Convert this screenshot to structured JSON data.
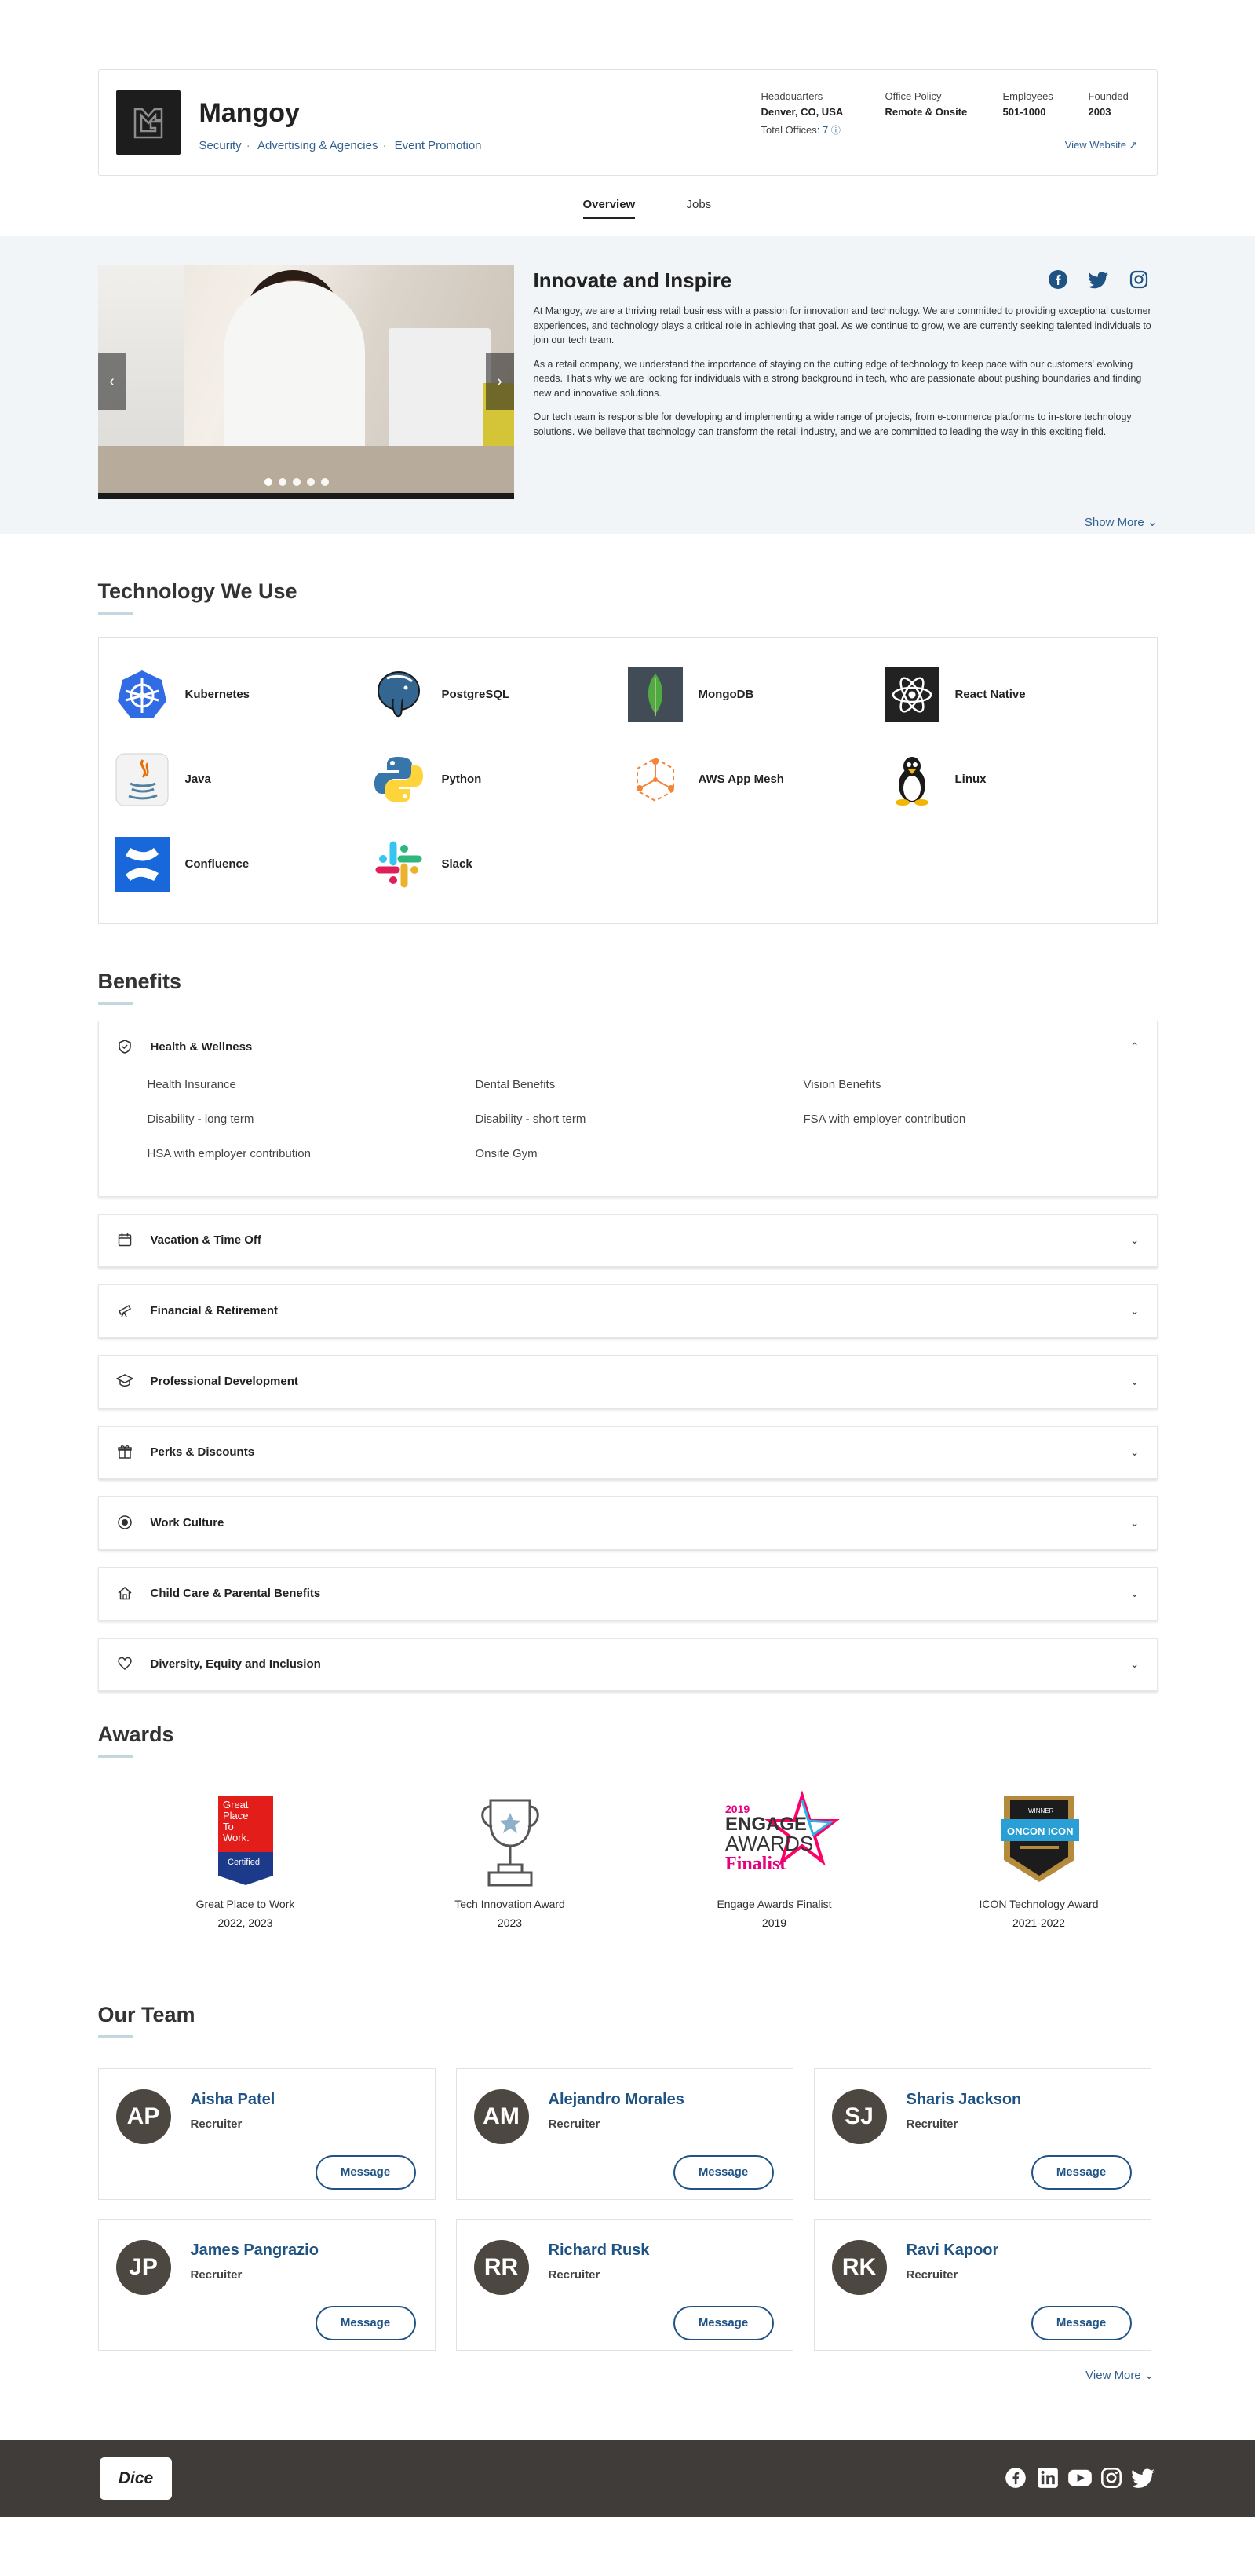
{
  "company": {
    "name": "Mangoy",
    "tags": [
      "Security",
      "Advertising & Agencies",
      "Event Promotion"
    ],
    "facts": [
      {
        "label": "Headquarters",
        "value": "Denver, CO, USA"
      },
      {
        "label": "Office Policy",
        "value": "Remote & Onsite"
      },
      {
        "label": "Employees",
        "value": "501-1000"
      },
      {
        "label": "Founded",
        "value": "2003"
      }
    ],
    "total_offices_label": "Total Offices:",
    "total_offices_value": "7",
    "view_website": "View Website"
  },
  "tabs": [
    "Overview",
    "Jobs"
  ],
  "about": {
    "title": "Innovate and Inspire",
    "paragraphs": [
      "At Mangoy, we are a thriving retail business with a passion for innovation and technology. We are committed to providing exceptional customer experiences, and technology plays a critical role in achieving that goal. As we continue to grow, we are currently seeking talented individuals to join our tech team.",
      "As a retail company, we understand the importance of staying on the cutting edge of technology to keep pace with our customers' evolving needs. That's why we are looking for individuals with a strong background in tech, who are passionate about pushing boundaries and finding new and innovative solutions.",
      "Our tech team is responsible for developing and implementing a wide range of projects, from e-commerce platforms to in-store technology solutions. We believe that technology can transform the retail industry, and we are committed to leading the way in this exciting field."
    ],
    "show_more": "Show More",
    "social_icons": [
      "facebook-icon",
      "twitter-icon",
      "instagram-icon"
    ],
    "carousel_slides": 5,
    "carousel_active": 1
  },
  "tech": {
    "title": "Technology We Use",
    "items": [
      {
        "name": "Kubernetes",
        "icon": "kubernetes-icon"
      },
      {
        "name": "PostgreSQL",
        "icon": "postgresql-icon"
      },
      {
        "name": "MongoDB",
        "icon": "mongodb-icon"
      },
      {
        "name": "React Native",
        "icon": "react-icon"
      },
      {
        "name": "Java",
        "icon": "java-icon"
      },
      {
        "name": "Python",
        "icon": "python-icon"
      },
      {
        "name": "AWS App Mesh",
        "icon": "aws-app-mesh-icon"
      },
      {
        "name": "Linux",
        "icon": "linux-icon"
      },
      {
        "name": "Confluence",
        "icon": "confluence-icon"
      },
      {
        "name": "Slack",
        "icon": "slack-icon"
      }
    ]
  },
  "benefits": {
    "title": "Benefits",
    "groups": [
      {
        "title": "Health & Wellness",
        "icon": "shield-icon",
        "expanded": true,
        "items": [
          "Health Insurance",
          "Dental Benefits",
          "Vision Benefits",
          "Disability - long term",
          "Disability - short term",
          "FSA with employer contribution",
          "HSA with employer contribution",
          "Onsite Gym"
        ]
      },
      {
        "title": "Vacation & Time Off",
        "icon": "calendar-icon",
        "expanded": false,
        "items": []
      },
      {
        "title": "Financial & Retirement",
        "icon": "telescope-icon",
        "expanded": false,
        "items": []
      },
      {
        "title": "Professional Development",
        "icon": "graduation-cap-icon",
        "expanded": false,
        "items": []
      },
      {
        "title": "Perks & Discounts",
        "icon": "gift-icon",
        "expanded": false,
        "items": []
      },
      {
        "title": "Work Culture",
        "icon": "target-icon",
        "expanded": false,
        "items": []
      },
      {
        "title": "Child Care & Parental Benefits",
        "icon": "house-icon",
        "expanded": false,
        "items": []
      },
      {
        "title": "Diversity, Equity and Inclusion",
        "icon": "heart-icon",
        "expanded": false,
        "items": []
      }
    ]
  },
  "awards": {
    "title": "Awards",
    "items": [
      {
        "name": "Great Place to Work",
        "year": "2022, 2023",
        "badge_lines": [
          "Great",
          "Place",
          "To",
          "Work.",
          "Certified"
        ]
      },
      {
        "name": "Tech Innovation Award",
        "year": "2023",
        "badge_lines": []
      },
      {
        "name": "Engage Awards Finalist",
        "year": "2019",
        "badge_lines": [
          "2019",
          "ENGAGE",
          "AWARDS",
          "Finalist"
        ]
      },
      {
        "name": "ICON Technology Award",
        "year": "2021-2022",
        "badge_lines": [
          "WINNER",
          "ONCON ICON"
        ]
      }
    ]
  },
  "team": {
    "title": "Our Team",
    "members": [
      {
        "initials": "AP",
        "name": "Aisha Patel",
        "role": "Recruiter"
      },
      {
        "initials": "AM",
        "name": "Alejandro Morales",
        "role": "Recruiter"
      },
      {
        "initials": "SJ",
        "name": "Sharis Jackson",
        "role": "Recruiter"
      },
      {
        "initials": "JP",
        "name": "James Pangrazio",
        "role": "Recruiter"
      },
      {
        "initials": "RR",
        "name": "Richard Rusk",
        "role": "Recruiter"
      },
      {
        "initials": "RK",
        "name": "Ravi Kapoor",
        "role": "Recruiter"
      }
    ],
    "message_label": "Message",
    "view_more": "View More"
  },
  "footer": {
    "brand": "Dice",
    "social_icons": [
      "facebook-icon",
      "linkedin-icon",
      "youtube-icon",
      "instagram-icon",
      "twitter-icon"
    ]
  },
  "colors": {
    "link": "#2f5f8f",
    "accent": "#1f5384",
    "band": "#f2f5f7",
    "footer": "#3f3c39",
    "avatar": "#4d4741"
  }
}
